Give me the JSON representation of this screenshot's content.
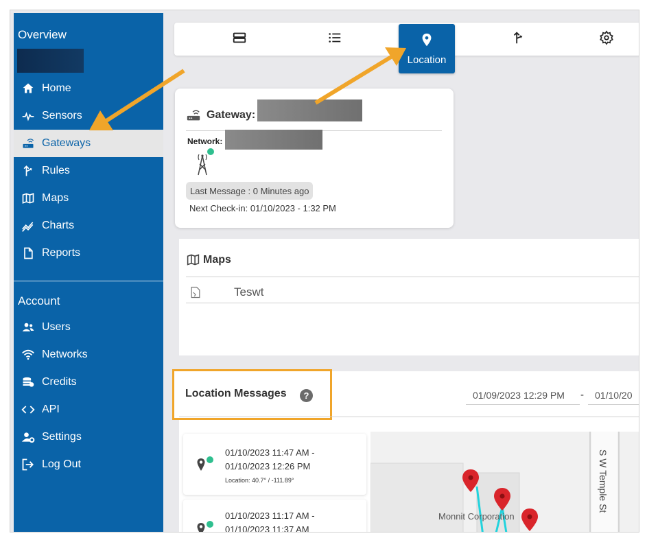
{
  "sidebar": {
    "overview_heading": "Overview",
    "account_heading": "Account",
    "items": [
      {
        "label": "Home",
        "icon": "home-icon"
      },
      {
        "label": "Sensors",
        "icon": "pulse-icon"
      },
      {
        "label": "Gateways",
        "icon": "router-icon"
      },
      {
        "label": "Rules",
        "icon": "split-arrow-icon"
      },
      {
        "label": "Maps",
        "icon": "map-icon"
      },
      {
        "label": "Charts",
        "icon": "trend-chart-icon"
      },
      {
        "label": "Reports",
        "icon": "document-icon"
      }
    ],
    "account_items": [
      {
        "label": "Users",
        "icon": "users-icon"
      },
      {
        "label": "Networks",
        "icon": "wifi-icon"
      },
      {
        "label": "Credits",
        "icon": "coins-icon"
      },
      {
        "label": "API",
        "icon": "code-icon"
      },
      {
        "label": "Settings",
        "icon": "user-gear-icon"
      },
      {
        "label": "Log Out",
        "icon": "logout-icon"
      }
    ],
    "active_item": "Gateways"
  },
  "tabs": {
    "active_label": "Location",
    "icons": [
      "summary-icon",
      "list-icon",
      "location-pin-icon",
      "rules-icon",
      "gear-icon"
    ]
  },
  "gateway_card": {
    "title": "Gateway:",
    "network_label": "Network:",
    "last_message": "Last Message : 0 Minutes ago",
    "next_checkin": "Next Check-in: 01/10/2023 - 1:32 PM"
  },
  "maps_panel": {
    "heading": "Maps",
    "rows": [
      {
        "name": "Teswt"
      }
    ]
  },
  "location_messages": {
    "heading": "Location Messages",
    "help": "?",
    "date_from": "01/09/2023 12:29 PM",
    "date_separator": "-",
    "date_to": "01/10/20",
    "messages": [
      {
        "line1": "01/10/2023 11:47 AM -",
        "line2": "01/10/2023 12:26 PM",
        "location": "Location: 40.7° / -111.89°"
      },
      {
        "line1": "01/10/2023 11:17 AM -",
        "line2": "01/10/2023 11:37 AM",
        "location": ""
      }
    ],
    "map": {
      "street_label": "S W Temple St",
      "place_label": "Monnit Corporation"
    }
  },
  "colors": {
    "brand_blue": "#0a63a8",
    "annotation_orange": "#f0a52a",
    "status_green": "#2fbf8f",
    "pin_red": "#d9252b"
  }
}
